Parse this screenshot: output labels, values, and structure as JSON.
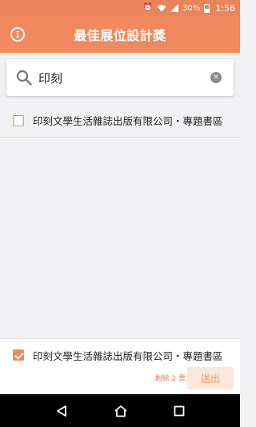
{
  "status_bar": {
    "battery": "30%",
    "time": "1:56"
  },
  "app_bar": {
    "title": "最佳展位設計獎",
    "info_icon": "info-icon"
  },
  "search": {
    "value": "印刻",
    "icons": [
      "search-icon",
      "clear-icon"
    ]
  },
  "results": [
    {
      "label": "印刻文學生活雜誌出版有限公司・專題書區",
      "checked": false
    }
  ],
  "selection": {
    "label": "印刻文學生活雜誌出版有限公司・專題書區",
    "checked": true,
    "remaining": "剩餘 2 票",
    "submit_label": "送出"
  },
  "colors": {
    "accent": "#f0895e",
    "status_bar": "#e8855a"
  }
}
